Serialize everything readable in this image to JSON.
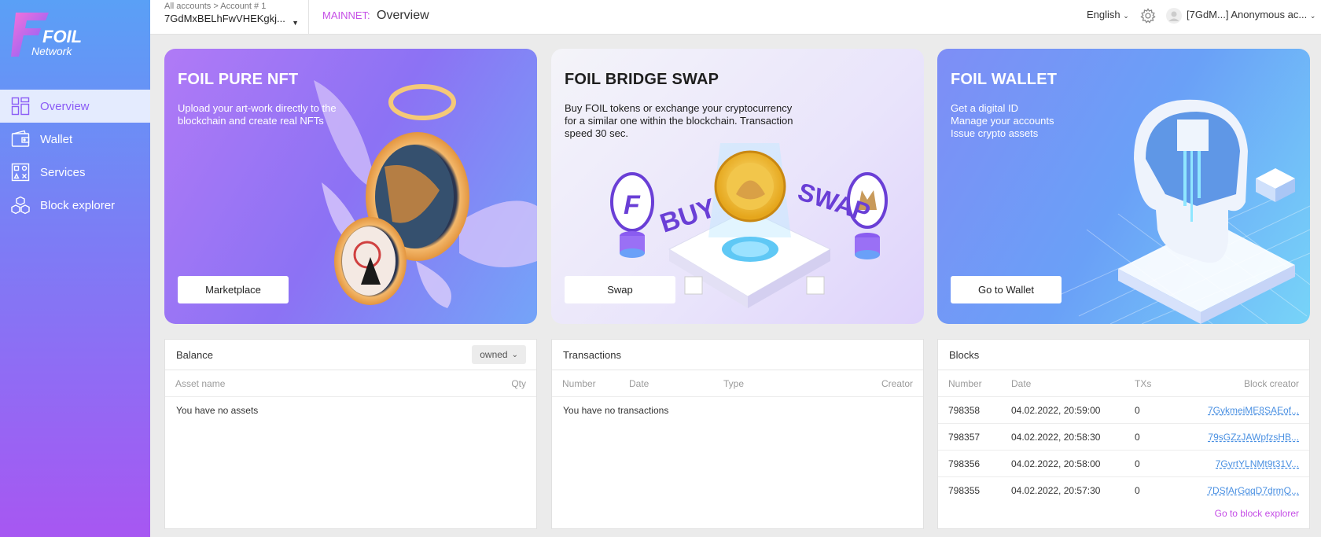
{
  "brand": {
    "name": "FOIL",
    "subtitle": "Network"
  },
  "sidebar": {
    "items": [
      {
        "label": "Overview",
        "icon": "overview-grid-icon",
        "active": true
      },
      {
        "label": "Wallet",
        "icon": "wallet-icon",
        "active": false
      },
      {
        "label": "Services",
        "icon": "services-icon",
        "active": false
      },
      {
        "label": "Block explorer",
        "icon": "block-explorer-icon",
        "active": false
      }
    ]
  },
  "topbar": {
    "account_path": "All accounts > Account # 1",
    "account_address": "7GdMxBELhFwVHEKgkj...",
    "network": "MAINNET:",
    "page_title": "Overview",
    "language": "English",
    "user": "[7GdM...] Anonymous ac..."
  },
  "cards": [
    {
      "title": "FOIL PURE NFT",
      "desc": "Upload your art-work directly to the\nblockchain and create real NFTs",
      "button": "Marketplace"
    },
    {
      "title": "FOIL BRIDGE SWAP",
      "desc": "Buy FOIL tokens or exchange your cryptocurrency\nfor a similar one within the blockchain. Transaction\nspeed 30 sec.",
      "button": "Swap",
      "art_text": [
        "BUY",
        "SWAP"
      ]
    },
    {
      "title": "FOIL WALLET",
      "desc": "Get a digital ID\nManage your accounts\nIssue crypto assets",
      "button": "Go to Wallet"
    }
  ],
  "balance": {
    "title": "Balance",
    "filter": "owned",
    "columns": [
      "Asset name",
      "Qty"
    ],
    "empty": "You have no assets"
  },
  "transactions": {
    "title": "Transactions",
    "columns": [
      "Number",
      "Date",
      "Type",
      "Creator"
    ],
    "empty": "You have no transactions"
  },
  "blocks": {
    "title": "Blocks",
    "columns": [
      "Number",
      "Date",
      "TXs",
      "Block creator"
    ],
    "rows": [
      {
        "number": "798358",
        "date": "04.02.2022, 20:59:00",
        "txs": "0",
        "creator": "7GykmeiME8SAEof..."
      },
      {
        "number": "798357",
        "date": "04.02.2022, 20:58:30",
        "txs": "0",
        "creator": "79sGZzJAWpfzsHB..."
      },
      {
        "number": "798356",
        "date": "04.02.2022, 20:58:00",
        "txs": "0",
        "creator": "7GyrtYLNMt9t31V..."
      },
      {
        "number": "798355",
        "date": "04.02.2022, 20:57:30",
        "txs": "0",
        "creator": "7DSfArGqqD7drmQ..."
      }
    ],
    "link": "Go to block explorer"
  },
  "colors": {
    "accent": "#c54ee6",
    "link": "#4a90e2",
    "sidebar_top": "#5aa0f6",
    "sidebar_bottom": "#a757f2"
  }
}
